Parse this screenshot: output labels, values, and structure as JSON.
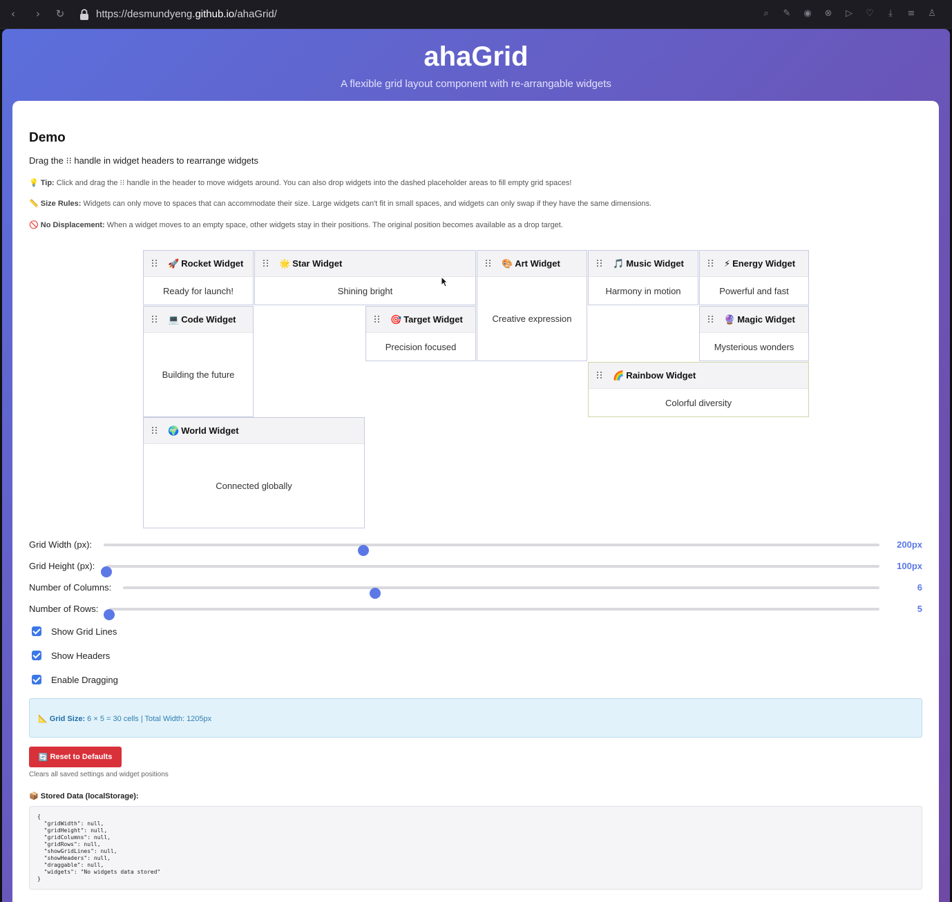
{
  "browser": {
    "url_prefix": "https://desmundyeng.",
    "url_domain": "github.io",
    "url_path": "/ahaGrid/"
  },
  "header": {
    "title": "ahaGrid",
    "subtitle": "A flexible grid layout component with re-arrangable widgets"
  },
  "demo": {
    "title": "Demo",
    "instruction": "Drag the ⁝⁝ handle in widget headers to rearrange widgets",
    "tip_label": "Tip:",
    "tip_text": " Click and drag the ⁝⁝ handle in the header to move widgets around. You can also drop widgets into the dashed placeholder areas to fill empty grid spaces!",
    "rules_label": "Size Rules:",
    "rules_text": " Widgets can only move to spaces that can accommodate their size. Large widgets can't fit in small spaces, and widgets can only swap if they have the same dimensions.",
    "nodisp_label": "No Displacement:",
    "nodisp_text": " When a widget moves to an empty space, other widgets stay in their positions. The original position becomes available as a drop target."
  },
  "widgets": [
    {
      "emoji": "🚀",
      "title": "Rocket Widget",
      "body": "Ready for launch!"
    },
    {
      "emoji": "🌟",
      "title": "Star Widget",
      "body": "Shining bright"
    },
    {
      "emoji": "🎨",
      "title": "Art Widget",
      "body": "Creative expression"
    },
    {
      "emoji": "🎵",
      "title": "Music Widget",
      "body": "Harmony in motion"
    },
    {
      "emoji": "⚡",
      "title": "Energy Widget",
      "body": "Powerful and fast"
    },
    {
      "emoji": "💻",
      "title": "Code Widget",
      "body": "Building the future"
    },
    {
      "emoji": "🎯",
      "title": "Target Widget",
      "body": "Precision focused"
    },
    {
      "emoji": "🔮",
      "title": "Magic Widget",
      "body": "Mysterious wonders"
    },
    {
      "emoji": "🌈",
      "title": "Rainbow Widget",
      "body": "Colorful diversity"
    },
    {
      "emoji": "🌍",
      "title": "World Widget",
      "body": "Connected globally"
    }
  ],
  "controls": {
    "sliders": [
      {
        "label": "Grid Width (px):",
        "value": "200px",
        "level": 0.335
      },
      {
        "label": "Grid Height (px):",
        "value": "100px",
        "level": 0.0
      },
      {
        "label": "Number of Columns:",
        "value": "6",
        "level": 0.333
      },
      {
        "label": "Number of Rows:",
        "value": "5",
        "level": 0.0
      }
    ],
    "checkboxes": [
      {
        "label": "Show Grid Lines",
        "checked": true
      },
      {
        "label": "Show Headers",
        "checked": true
      },
      {
        "label": "Enable Dragging",
        "checked": true
      }
    ]
  },
  "info": {
    "icon": "📐",
    "label": "Grid Size:",
    "text": " 6 × 5 = 30 cells | Total Width: 1205px"
  },
  "reset": {
    "icon": "🔄",
    "label": "Reset to Defaults",
    "note": "Clears all saved settings and widget positions"
  },
  "stored": {
    "icon": "📦",
    "label": "Stored Data (localStorage):",
    "json": "{\n  \"gridWidth\": null,\n  \"gridHeight\": null,\n  \"gridColumns\": null,\n  \"gridRows\": null,\n  \"showGridLines\": null,\n  \"showHeaders\": null,\n  \"draggable\": null,\n  \"widgets\": \"No widgets data stored\"\n}"
  }
}
